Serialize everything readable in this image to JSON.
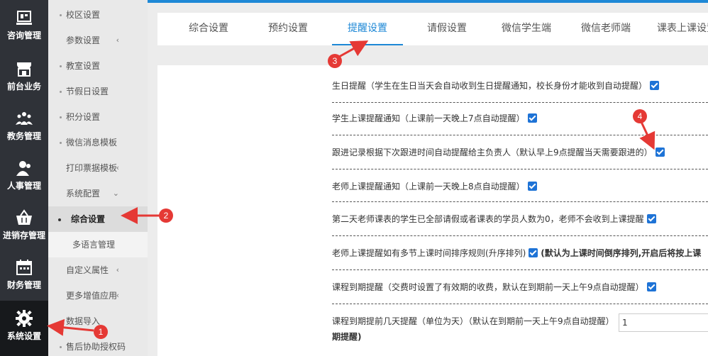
{
  "rail": [
    {
      "label": "咨询管理",
      "icon": "consult-icon"
    },
    {
      "label": "前台业务",
      "icon": "storefront-icon"
    },
    {
      "label": "教务管理",
      "icon": "people-group-icon"
    },
    {
      "label": "人事管理",
      "icon": "person-icon"
    },
    {
      "label": "进销存管理",
      "icon": "basket-icon"
    },
    {
      "label": "财务管理",
      "icon": "calendar-icon"
    },
    {
      "label": "系统设置",
      "icon": "gear-icon"
    }
  ],
  "submenu": {
    "items": [
      {
        "label": "校区设置"
      },
      {
        "label": "参数设置",
        "chevron": "‹"
      },
      {
        "label": "教室设置"
      },
      {
        "label": "节假日设置"
      },
      {
        "label": "积分设置"
      },
      {
        "label": "微信消息模板"
      },
      {
        "label": "打印票据模板",
        "chevron": "‹"
      },
      {
        "label": "系统配置",
        "chevron": "⌄"
      },
      {
        "label": "综合设置"
      },
      {
        "label": "多语言管理"
      },
      {
        "label": "自定义属性",
        "chevron": "‹"
      },
      {
        "label": "更多增值应用",
        "chevron": "‹"
      },
      {
        "label": "数据导入"
      },
      {
        "label": "售后协助授权码"
      }
    ]
  },
  "tabs": [
    "综合设置",
    "预约设置",
    "提醒设置",
    "请假设置",
    "微信学生端",
    "微信老师端",
    "课表上课设置"
  ],
  "settings": [
    {
      "text": "生日提醒（学生在生日当天会自动收到生日提醒通知，校长身份才能收到自动提醒）"
    },
    {
      "text": "学生上课提醒通知（上课前一天晚上7点自动提醒）"
    },
    {
      "text": "跟进记录根据下次跟进时间自动提醒给主负责人（默认早上9点提醒当天需要跟进的）"
    },
    {
      "text": "老师上课提醒通知（上课前一天晚上8点自动提醒）"
    },
    {
      "text": "第二天老师课表的学生已全部请假或者课表的学员人数为0，老师不会收到上课提醒"
    },
    {
      "text": "老师上课提醒如有多节上课时间排序规则(升序排列)",
      "note": "(默认为上课时间倒序排列,开启后将按上课"
    },
    {
      "text": "课程到期提醒（交费时设置了有效期的收费，默认在到期前一天上午9点自动提醒）"
    },
    {
      "text": "课程到期提前几天提醒（单位为天）（默认在到期前一天上午9点自动提醒）",
      "line2": "期提醒)",
      "input_value": "1"
    }
  ],
  "annotations": [
    "1",
    "2",
    "3",
    "4"
  ],
  "colors": {
    "accent": "#1e88d6",
    "annotation": "#e53935",
    "rail_bg": "#2f3238"
  }
}
